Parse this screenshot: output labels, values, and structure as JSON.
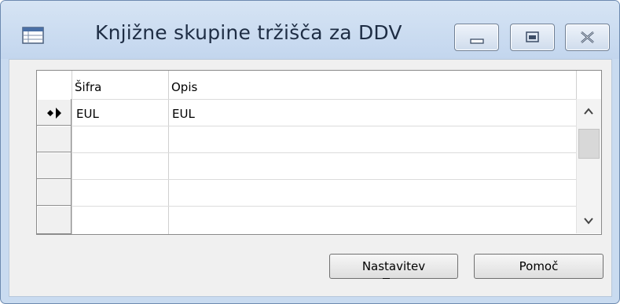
{
  "window": {
    "title": "Knjižne skupine tržišča za DDV",
    "app_icon": "table-window-icon",
    "controls": [
      "minimize-icon",
      "maximize-icon",
      "close-icon"
    ]
  },
  "grid": {
    "columns": [
      {
        "label": "Šifra"
      },
      {
        "label": "Opis"
      }
    ],
    "rows": [
      {
        "indicator": "current-new-row-icon",
        "sifra": "EUL",
        "opis": "EUL"
      },
      {
        "indicator": "",
        "sifra": "",
        "opis": ""
      },
      {
        "indicator": "",
        "sifra": "",
        "opis": ""
      },
      {
        "indicator": "",
        "sifra": "",
        "opis": ""
      },
      {
        "indicator": "",
        "sifra": "",
        "opis": ""
      }
    ],
    "scrollbar": {
      "up": "chevron-up-icon",
      "down": "chevron-down-icon"
    }
  },
  "buttons": {
    "setup_label": "Nastavitev",
    "setup_mnemonic": "s",
    "help_label": "Pomoč"
  }
}
